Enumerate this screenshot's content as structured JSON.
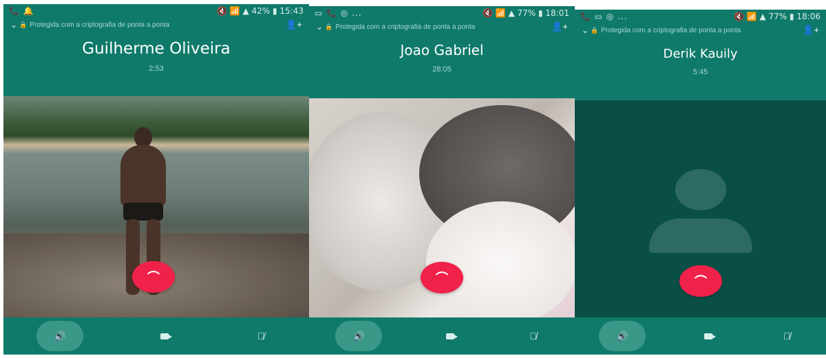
{
  "calls": [
    {
      "status": {
        "left": "📞 🔔",
        "right": "🔇 📶 ▲ 42% ▮ 15:43"
      },
      "encryption": "Protegida com a criptografia de ponta a ponta",
      "name": "Guilherme Oliveira",
      "duration": "2:53",
      "media": "video-beach",
      "controls": {
        "speaker": "speaker-icon",
        "video": "video-icon",
        "mute": "mute-icon"
      }
    },
    {
      "status": {
        "left": "▭ 📞 ◎ ...",
        "right": "🔇 📶 ▲ 77% ▮ 18:01"
      },
      "encryption": "Protegida com a criptografia de ponta a ponta",
      "name": "Joao Gabriel",
      "duration": "28:05",
      "media": "video-cats",
      "controls": {
        "speaker": "speaker-icon",
        "video": "video-icon",
        "mute": "mute-icon"
      }
    },
    {
      "status": {
        "left": "📞 ▭ ◎ ...",
        "right": "🔇 📶 ▲ 77% ▮ 18:06"
      },
      "encryption": "Protegida com a criptografia de ponta a ponta",
      "name": "Derik Kauily",
      "duration": "5:45",
      "media": "avatar-placeholder",
      "controls": {
        "speaker": "speaker-icon",
        "video": "video-icon",
        "mute": "mute-icon"
      }
    }
  ],
  "colors": {
    "app_teal": "#0f7a6a",
    "end_call_red": "#f0224a",
    "placeholder_bg": "#0a4f46"
  }
}
